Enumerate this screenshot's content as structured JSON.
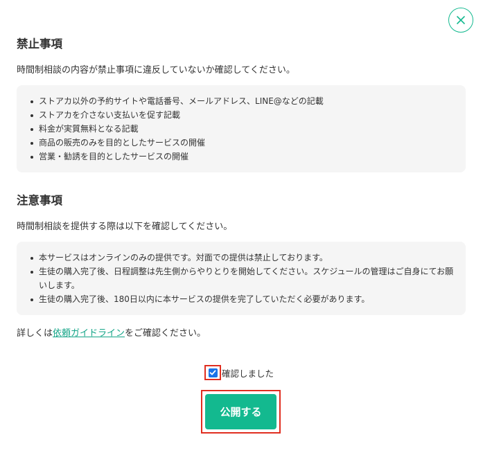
{
  "close": {
    "icon": "close-icon",
    "color": "#13b98f"
  },
  "prohibited": {
    "title": "禁止事項",
    "intro": "時間制相談の内容が禁止事項に違反していないか確認してください。",
    "items": [
      "ストアカ以外の予約サイトや電話番号、メールアドレス、LINE@などの記載",
      "ストアカを介さない支払いを促す記載",
      "料金が実質無料となる記載",
      "商品の販売のみを目的としたサービスの開催",
      "営業・勧誘を目的としたサービスの開催"
    ]
  },
  "notes": {
    "title": "注意事項",
    "intro": "時間制相談を提供する際は以下を確認してください。",
    "items": [
      "本サービスはオンラインのみの提供です。対面での提供は禁止しております。",
      "生徒の購入完了後、日程調整は先生側からやりとりを開始してください。スケジュールの管理はご自身にてお願いします。",
      "生徒の購入完了後、180日以内に本サービスの提供を完了していただく必要があります。"
    ]
  },
  "more": {
    "prefix": "詳しくは",
    "link": "依頼ガイドライン",
    "suffix": "をご確認ください。"
  },
  "confirm": {
    "label": "確認しました",
    "checked": true
  },
  "publish": {
    "label": "公開する"
  },
  "colors": {
    "accent": "#13b98f",
    "link": "#13a487",
    "highlight": "#e02d1f",
    "checkbox": "#1a73e8"
  }
}
